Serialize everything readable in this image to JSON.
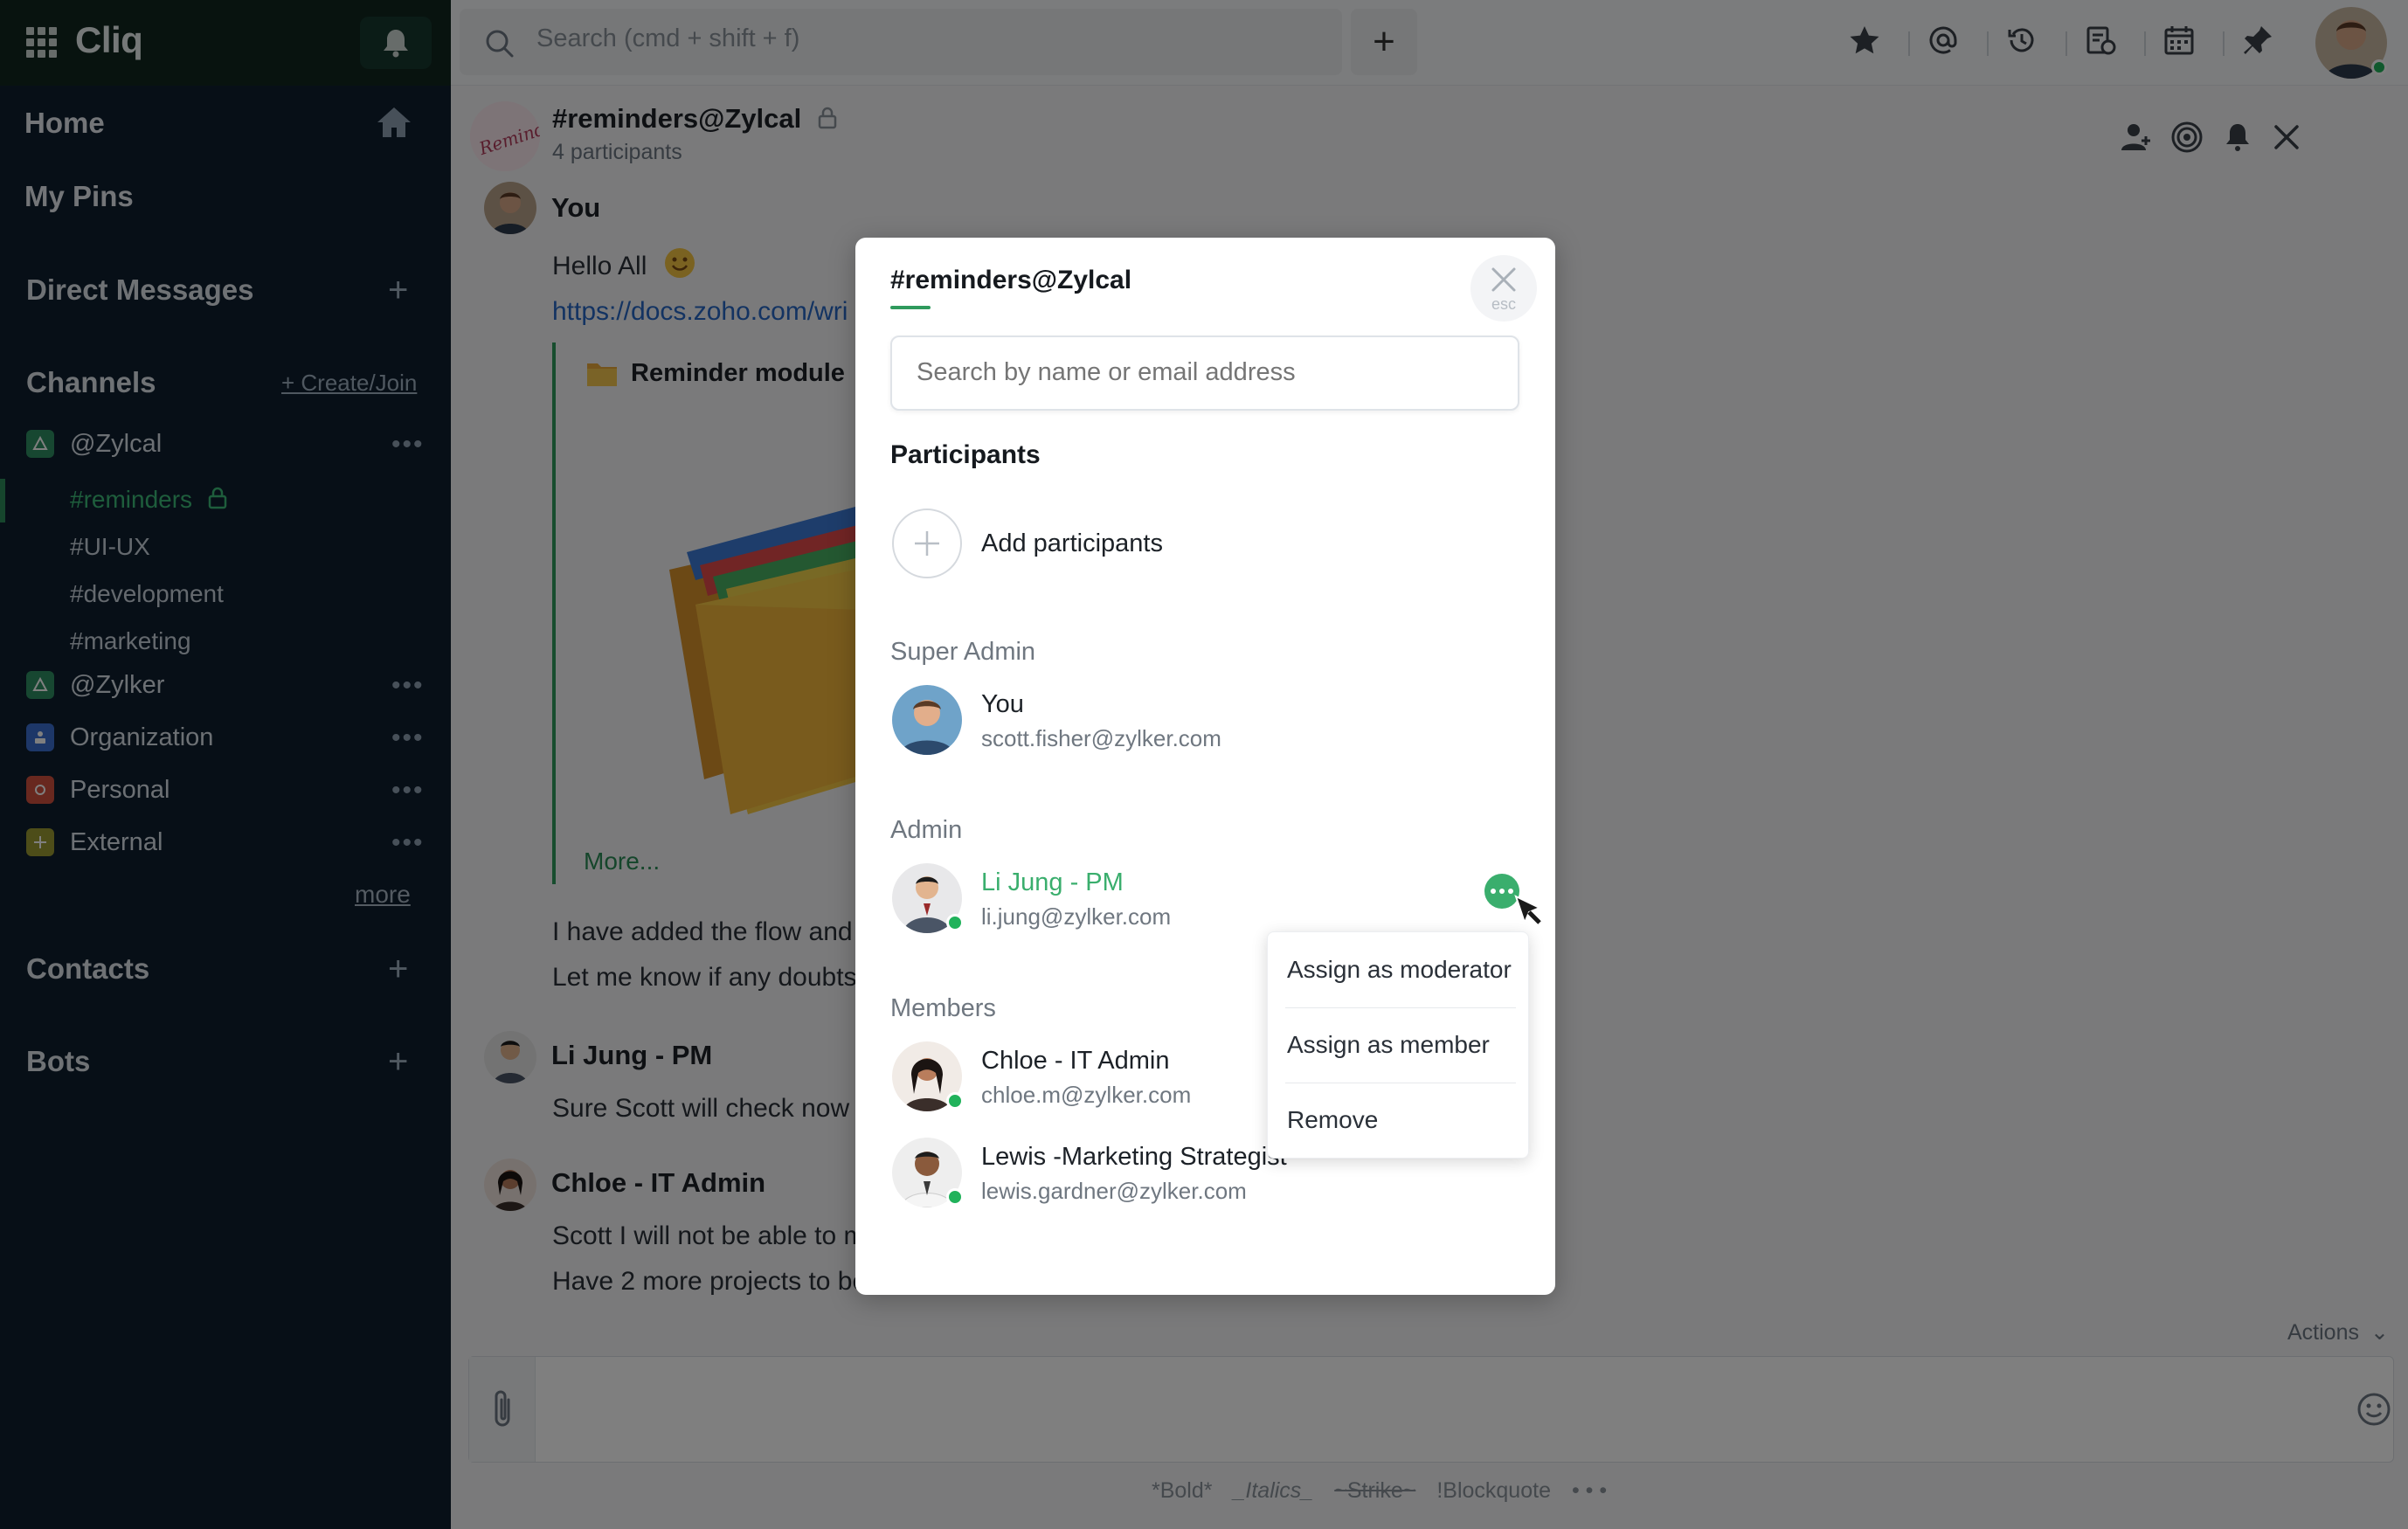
{
  "app": {
    "name": "Cliq"
  },
  "sidebar": {
    "nav": [
      "Home",
      "My Pins"
    ],
    "direct_messages": "Direct Messages",
    "channels": "Channels",
    "create_join": "+ Create/Join",
    "orgs": [
      {
        "name": "@Zylcal",
        "color": "#2f8f62"
      },
      {
        "name": "@Zylker",
        "color": "#2f8f62"
      },
      {
        "name": "Organization",
        "color": "#3a6fd1"
      },
      {
        "name": "Personal",
        "color": "#d0503f"
      },
      {
        "name": "External",
        "color": "#9a9a32"
      }
    ],
    "channels_list": [
      "#reminders",
      "#UI-UX",
      "#development",
      "#marketing"
    ],
    "more": "more",
    "contacts": "Contacts",
    "bots": "Bots"
  },
  "topbar": {
    "search_placeholder": "Search (cmd + shift + f)",
    "new_label": "+"
  },
  "chat": {
    "title": "#reminders@Zylcal",
    "subtitle": "4 participants",
    "messages": [
      {
        "name": "You",
        "lines": [
          "Hello All"
        ]
      },
      {
        "link": "https://docs.zoho.com/wri"
      },
      {
        "attachment_title": "Reminder module",
        "more": "More..."
      },
      {
        "lines": [
          "I have added the flow and v",
          "Let me know if any doubts"
        ]
      },
      {
        "name": "Li Jung - PM",
        "lines": [
          "Sure Scott will check now"
        ]
      },
      {
        "name": "Chloe - IT Admin",
        "lines": [
          "Scott I will not be able to m",
          "Have 2 more projects to be"
        ]
      }
    ],
    "actions_label": "Actions",
    "format": [
      "*Bold*",
      "_Italics_",
      "~Strike~",
      "!Blockquote",
      "• • •"
    ]
  },
  "modal": {
    "title": "#reminders@Zylcal",
    "esc": "esc",
    "search_placeholder": "Search by name or email address",
    "participants": "Participants",
    "add_participants": "Add participants",
    "super_admin": "Super Admin",
    "admin": "Admin",
    "members": "Members",
    "super_admin_user": {
      "name": "You",
      "email": "scott.fisher@zylker.com"
    },
    "admin_user": {
      "name": "Li Jung - PM",
      "email": "li.jung@zylker.com"
    },
    "member_users": [
      {
        "name": "Chloe - IT Admin",
        "email": "chloe.m@zylker.com"
      },
      {
        "name": "Lewis -Marketing Strategist",
        "email": "lewis.gardner@zylker.com"
      }
    ],
    "menu": [
      "Assign as moderator",
      "Assign as member",
      "Remove"
    ]
  },
  "colors": {
    "accent": "#2f9a5d",
    "highlight_name": "#3aae6d",
    "online": "#21b25b",
    "sidebar_bg": "#0f1e2e"
  }
}
